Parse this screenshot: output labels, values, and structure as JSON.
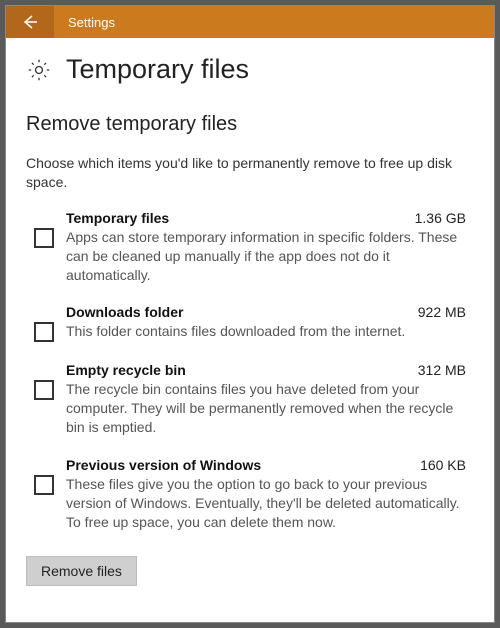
{
  "titlebar": {
    "title": "Settings"
  },
  "page": {
    "title": "Temporary files",
    "section_title": "Remove temporary files",
    "section_desc": "Choose which items you'd like to permanently remove to free up disk space."
  },
  "items": [
    {
      "title": "Temporary files",
      "size": "1.36 GB",
      "desc": "Apps can store temporary information in specific folders. These can be cleaned up manually if the app does not do it automatically."
    },
    {
      "title": "Downloads folder",
      "size": "922 MB",
      "desc": "This folder contains files downloaded from the internet."
    },
    {
      "title": "Empty recycle bin",
      "size": "312 MB",
      "desc": "The recycle bin contains files you have deleted from your computer. They will be permanently removed when the recycle bin is emptied."
    },
    {
      "title": "Previous version of Windows",
      "size": "160 KB",
      "desc": "These files give you the option to go back to your previous version of Windows. Eventually, they'll be deleted automatically. To free up space, you can delete them now."
    }
  ],
  "actions": {
    "remove": "Remove files"
  }
}
